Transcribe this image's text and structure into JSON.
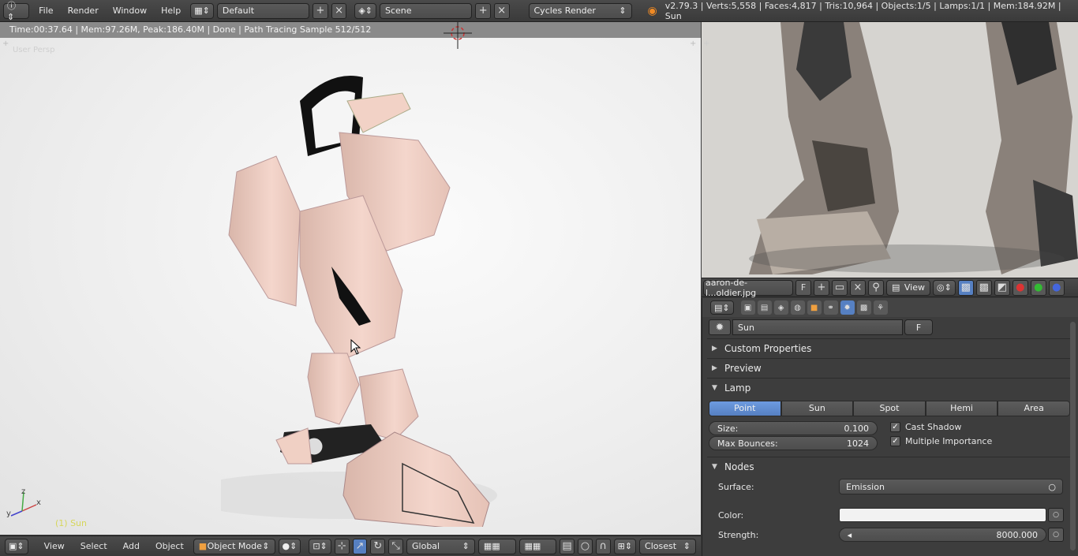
{
  "topbar": {
    "info_icon": "info-icon",
    "menus": [
      "File",
      "Render",
      "Window",
      "Help"
    ],
    "layout_name": "Default",
    "scene_name": "Scene",
    "render_engine": "Cycles Render",
    "stats": "v2.79.3 | Verts:5,558 | Faces:4,817 | Tris:10,964 | Objects:1/5 | Lamps:1/1 | Mem:184.92M | Sun"
  },
  "viewport": {
    "render_status": "Time:00:37.64 | Mem:97.26M, Peak:186.40M | Done | Path Tracing Sample 512/512",
    "view_label": "User Persp",
    "object_label": "(1) Sun",
    "axis_x": "x",
    "axis_y": "y",
    "axis_z": "z",
    "menus": [
      "View",
      "Select",
      "Add",
      "Object"
    ],
    "mode": "Object Mode",
    "orientation": "Global",
    "snap": "Closest"
  },
  "image_editor": {
    "image_name": "aaron-de-l...oldier.jpg",
    "fake_user": "F",
    "view_menu": "View"
  },
  "properties": {
    "datablock_name": "Sun",
    "fake_user": "F",
    "panels": {
      "custom_properties": "Custom Properties",
      "preview": "Preview",
      "lamp": "Lamp",
      "nodes": "Nodes"
    },
    "lamp_types": [
      "Point",
      "Sun",
      "Spot",
      "Hemi",
      "Area"
    ],
    "active_lamp_type": "Point",
    "size_label": "Size:",
    "size_value": "0.100",
    "bounces_label": "Max Bounces:",
    "bounces_value": "1024",
    "cast_shadow": "Cast Shadow",
    "multiple_importance": "Multiple Importance",
    "surface_label": "Surface:",
    "surface_value": "Emission",
    "color_label": "Color:",
    "strength_label": "Strength:",
    "strength_value": "8000.000"
  },
  "colors": {
    "accent": "#5680c2",
    "object_label": "#d6d65a",
    "viewport_bg": "#f4f4f4"
  }
}
